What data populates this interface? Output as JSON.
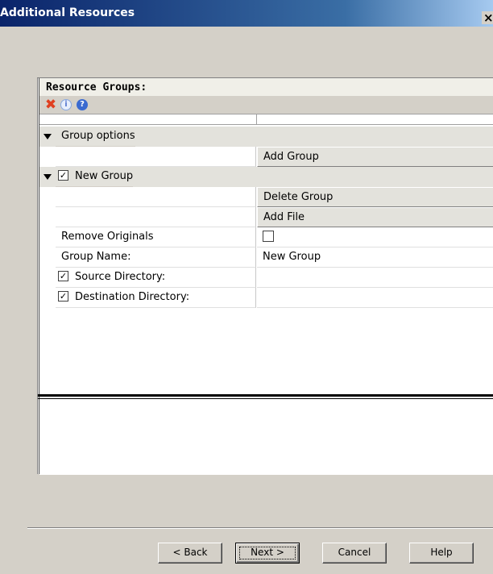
{
  "window": {
    "title": "Additional Resources",
    "close_glyph": "×"
  },
  "panel": {
    "header": "Resource Groups:",
    "toolbar": {
      "delete_icon": "delete-icon",
      "info_icon": "info-icon",
      "help_icon": "help-icon"
    }
  },
  "grid": {
    "rows": [
      {
        "label": "Group options"
      },
      {
        "value": "Add Group"
      },
      {
        "label": "New Group",
        "checked": true
      },
      {
        "value": "Delete Group"
      },
      {
        "value": "Add File"
      },
      {
        "label": "Remove Originals",
        "value_checked": false
      },
      {
        "label": "Group Name:",
        "value": "New Group"
      },
      {
        "label": "Source Directory:",
        "checked": true,
        "value": ""
      },
      {
        "label": "Destination Directory:",
        "checked": true,
        "value": ""
      }
    ]
  },
  "buttons": {
    "back": "< Back",
    "next": "Next >",
    "cancel": "Cancel",
    "help": "Help"
  },
  "colors": {
    "titlebar_start": "#0a246a",
    "titlebar_end": "#a6caf0",
    "dialog_bg": "#d4d0c8",
    "delete_icon": "#e04020",
    "help_icon": "#3a6ad0"
  }
}
